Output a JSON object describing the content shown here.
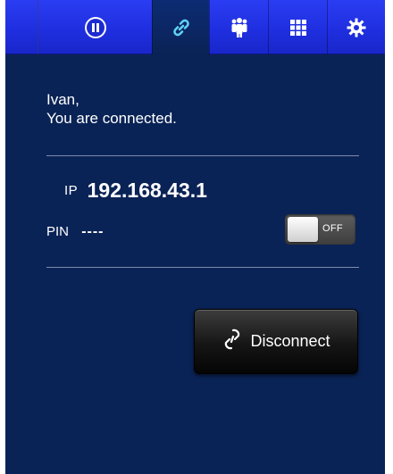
{
  "toolbar": {
    "tabs": [
      {
        "icon": "pause-icon",
        "active": false
      },
      {
        "icon": "link-icon",
        "active": true
      },
      {
        "icon": "users-icon",
        "active": false
      },
      {
        "icon": "grid-icon",
        "active": false
      },
      {
        "icon": "gear-icon",
        "active": false
      }
    ],
    "colors": {
      "bar": "#2233EE",
      "active_tab": "#0a2356"
    }
  },
  "greeting": {
    "name": "Ivan,",
    "status": "You are connected."
  },
  "connection": {
    "ip_label": "IP",
    "ip_value": "192.168.43.1",
    "pin_label": "PIN",
    "pin_value": "----",
    "pin_toggle": {
      "state_label": "OFF",
      "on": false
    }
  },
  "actions": {
    "disconnect_label": "Disconnect",
    "disconnect_icon": "link-icon"
  },
  "theme": {
    "background": "#0a2356",
    "text": "#ffffff"
  }
}
